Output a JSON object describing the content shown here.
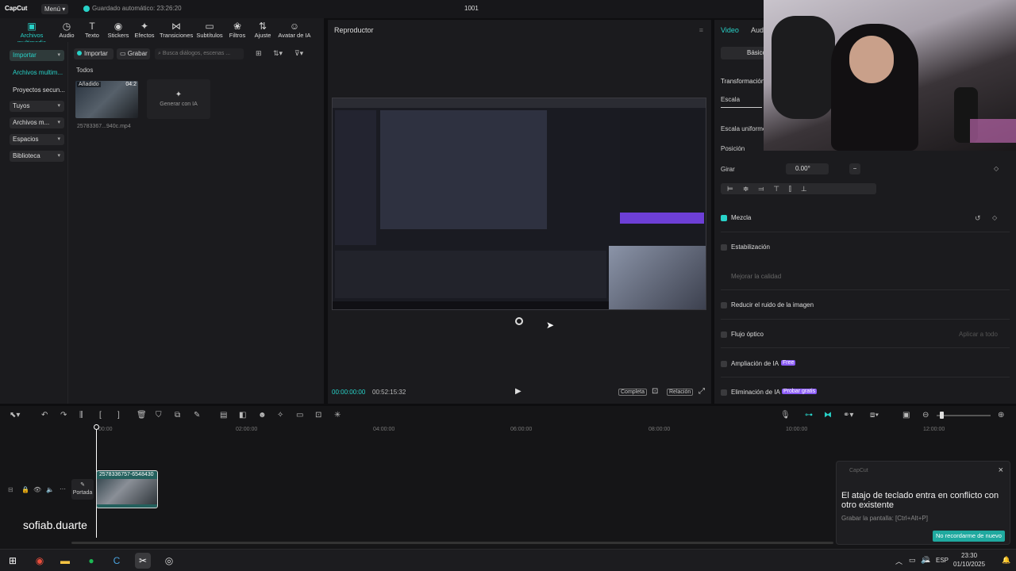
{
  "app": {
    "logo": "CapCut",
    "menu": "Menú",
    "autosave": "Guardado automático: 23:26:20",
    "project": "1001"
  },
  "toolbar": [
    {
      "icon": "media-icon",
      "glyph": "▣",
      "label": "Archivos multimedia"
    },
    {
      "icon": "audio-icon",
      "glyph": "◷",
      "label": "Audio"
    },
    {
      "icon": "text-icon",
      "glyph": "T",
      "label": "Texto"
    },
    {
      "icon": "stickers-icon",
      "glyph": "◉",
      "label": "Stickers"
    },
    {
      "icon": "effects-icon",
      "glyph": "✦",
      "label": "Efectos"
    },
    {
      "icon": "transitions-icon",
      "glyph": "⋈",
      "label": "Transiciones"
    },
    {
      "icon": "subtitles-icon",
      "glyph": "▭",
      "label": "Subtítulos"
    },
    {
      "icon": "filters-icon",
      "glyph": "❀",
      "label": "Filtros"
    },
    {
      "icon": "adjust-icon",
      "glyph": "⇅",
      "label": "Ajuste"
    },
    {
      "icon": "ai-avatar-icon",
      "glyph": "☺",
      "label": "Avatar de IA"
    }
  ],
  "nav": {
    "import": "Importar",
    "media": "Archivos multim...",
    "projects": "Proyectos secun...",
    "yours": "Tuyos",
    "media2": "Archivos m...",
    "spaces": "Espacios",
    "library": "Biblioteca"
  },
  "media": {
    "import_btn": "Importar",
    "record_btn": "Grabar",
    "search_placeholder": "Busca diálogos, escenas ...",
    "filter": "Todos",
    "added": "Añadido",
    "duration": "04:2",
    "filename": "25783367...940c.mp4",
    "generate": "Generar con IA"
  },
  "player": {
    "title": "Reproductor",
    "time_current": "00:00:00:00",
    "time_total": "00:52:15:32",
    "full": "Completa",
    "ratio": "Relación"
  },
  "props": {
    "tab_video": "Video",
    "tab_audio": "Audi",
    "basic": "Básico",
    "transform": "Transformación",
    "scale": "Escala",
    "uniform": "Escala uniforme",
    "position": "Posición",
    "rotate": "Girar",
    "rotate_value": "0.00°",
    "rotate_minus": "−",
    "blend": "Mezcla",
    "stabilization": "Estabilización",
    "quality": "Mejorar la calidad",
    "noise": "Reducir el ruido de la imagen",
    "flow": "Flujo óptico",
    "apply_all": "Aplicar a todo",
    "ai_upscale": "Ampliación de IA",
    "free": "Free",
    "ai_remove": "Eliminación de IA",
    "try_free": "Probar gratis"
  },
  "timeline": {
    "ticks": [
      "00:00",
      "02:00:00",
      "04:00:00",
      "06:00:00",
      "08:00:00",
      "10:00:00",
      "12:00:00"
    ],
    "cover": "Portada",
    "clip_name": "2578336757-6548430",
    "overlay_name": "sofiab.duarte"
  },
  "toast": {
    "app": "CapCut",
    "message": "El atajo de teclado entra en conflicto con otro existente",
    "detail": "Grabar la pantalla: [Ctrl+Alt+P]",
    "button": "No recordarme de nuevo"
  },
  "taskbar": {
    "lang": "ESP",
    "time": "23:30",
    "date": "01/10/2025"
  },
  "colors": {
    "accent": "#28d2c8",
    "purple": "#8b5cf6"
  }
}
